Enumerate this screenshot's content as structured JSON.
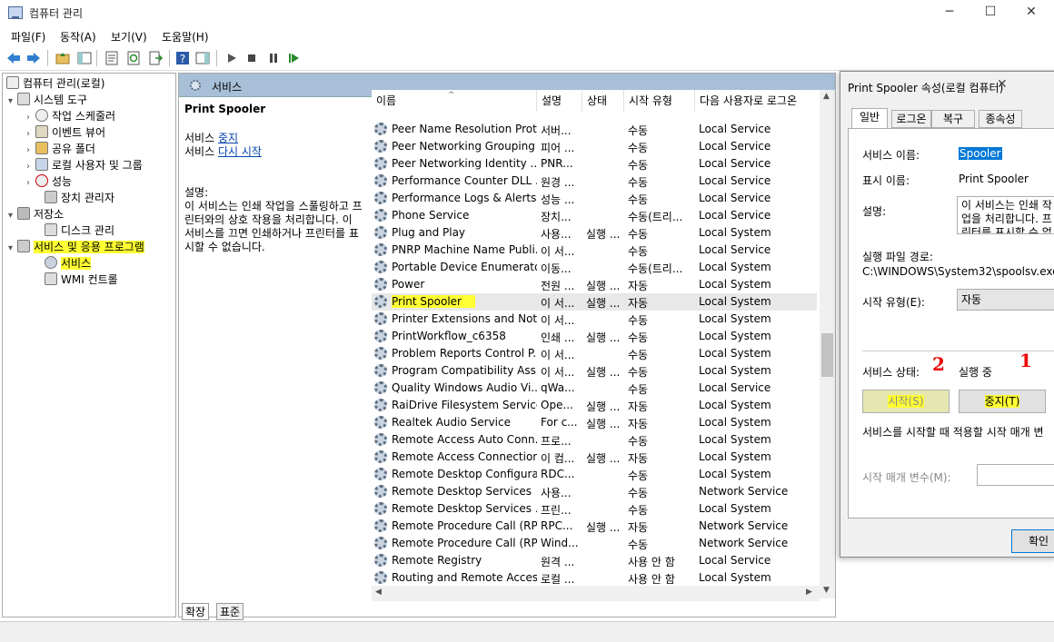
{
  "window": {
    "title": "컴퓨터 관리",
    "min": "─",
    "max": "☐",
    "close": "✕"
  },
  "menu": [
    "파일(F)",
    "동작(A)",
    "보기(V)",
    "도움말(H)"
  ],
  "tree": [
    {
      "label": "컴퓨터 관리(로컬)",
      "twisty": ""
    },
    {
      "label": "시스템 도구",
      "twisty": "▾"
    },
    {
      "label": "작업 스케줄러",
      "twisty": "›"
    },
    {
      "label": "이벤트 뷰어",
      "twisty": "›"
    },
    {
      "label": "공유 폴더",
      "twisty": "›"
    },
    {
      "label": "로컬 사용자 및 그룹",
      "twisty": "›"
    },
    {
      "label": "성능",
      "twisty": "›"
    },
    {
      "label": "장치 관리자",
      "twisty": ""
    },
    {
      "label": "저장소",
      "twisty": "▾"
    },
    {
      "label": "디스크 관리",
      "twisty": ""
    },
    {
      "label": "서비스 및 응용 프로그램",
      "twisty": "▾"
    },
    {
      "label": "서비스",
      "twisty": ""
    },
    {
      "label": "WMI 컨트롤",
      "twisty": ""
    }
  ],
  "services_header": "서비스",
  "info": {
    "title": "Print Spooler",
    "service_word": "서비스",
    "stop_link": "중지",
    "restart_link": "다시 시작",
    "desc_label": "설명:",
    "desc": "이 서비스는 인쇄 작업을 스풀링하고 프린터와의 상호 작용을 처리합니다. 이 서비스를 끄면 인쇄하거나 프린터를 표시할 수 없습니다."
  },
  "columns": [
    "이름",
    "설명",
    "상태",
    "시작 유형",
    "다음 사용자로 로그온"
  ],
  "services": [
    [
      "Peer Name Resolution Prot...",
      "서버...",
      "",
      "수동",
      "Local Service"
    ],
    [
      "Peer Networking Grouping",
      "피어 ...",
      "",
      "수동",
      "Local Service"
    ],
    [
      "Peer Networking Identity ...",
      "PNR...",
      "",
      "수동",
      "Local Service"
    ],
    [
      "Performance Counter DLL ...",
      "원경 ...",
      "",
      "수동",
      "Local Service"
    ],
    [
      "Performance Logs & Alerts",
      "성능 ...",
      "",
      "수동",
      "Local Service"
    ],
    [
      "Phone Service",
      "장치...",
      "",
      "수동(트리...",
      "Local Service"
    ],
    [
      "Plug and Play",
      "사용...",
      "실행 ...",
      "수동",
      "Local System"
    ],
    [
      "PNRP Machine Name Publi...",
      "이 서...",
      "",
      "수동",
      "Local Service"
    ],
    [
      "Portable Device Enumerato...",
      "이동...",
      "",
      "수동(트리...",
      "Local System"
    ],
    [
      "Power",
      "전원 ...",
      "실행 ...",
      "자동",
      "Local System"
    ],
    [
      "Print Spooler",
      "이 서...",
      "실행 ...",
      "자동",
      "Local System"
    ],
    [
      "Printer Extensions and Noti...",
      "이 서...",
      "",
      "수동",
      "Local System"
    ],
    [
      "PrintWorkflow_c6358",
      "인쇄 ...",
      "실행 ...",
      "수동",
      "Local System"
    ],
    [
      "Problem Reports Control P...",
      "이 서...",
      "",
      "수동",
      "Local System"
    ],
    [
      "Program Compatibility Assi...",
      "이 서...",
      "실행 ...",
      "수동",
      "Local System"
    ],
    [
      "Quality Windows Audio Vi...",
      "qWa...",
      "",
      "수동",
      "Local Service"
    ],
    [
      "RaiDrive Filesystem Service",
      "Ope...",
      "실행 ...",
      "자동",
      "Local System"
    ],
    [
      "Realtek Audio Service",
      "For c...",
      "실행 ...",
      "자동",
      "Local System"
    ],
    [
      "Remote Access Auto Conn...",
      "프로...",
      "",
      "수동",
      "Local System"
    ],
    [
      "Remote Access Connection...",
      "이 컴...",
      "실행 ...",
      "자동",
      "Local System"
    ],
    [
      "Remote Desktop Configura...",
      "RDC...",
      "",
      "수동",
      "Local System"
    ],
    [
      "Remote Desktop Services",
      "사용...",
      "",
      "수동",
      "Network Service"
    ],
    [
      "Remote Desktop Services ...",
      "프린...",
      "",
      "수동",
      "Local System"
    ],
    [
      "Remote Procedure Call (RP...",
      "RPC...",
      "실행 ...",
      "자동",
      "Network Service"
    ],
    [
      "Remote Procedure Call (RP...",
      "Wind...",
      "",
      "수동",
      "Network Service"
    ],
    [
      "Remote Registry",
      "원격 ...",
      "",
      "사용 안 함",
      "Local Service"
    ],
    [
      "Routing and Remote Access",
      "로컬 ...",
      "",
      "사용 안 함",
      "Local System"
    ]
  ],
  "bottom_tabs": [
    "확장",
    "표준"
  ],
  "dialog": {
    "title": "Print Spooler 속성(로컬 컴퓨터)",
    "close": "✕",
    "tabs": [
      "일반",
      "로그온",
      "복구",
      "종속성"
    ],
    "service_name_label": "서비스 이름:",
    "service_name": "Spooler",
    "display_name_label": "표시 이름:",
    "display_name": "Print Spooler",
    "desc_label": "설명:",
    "desc": "이 서비스는 인쇄 작업을 처리합니다. 프린터를 표시할 수 없",
    "path_label": "실행 파일 경로:",
    "path": "C:\\WINDOWS\\System32\\spoolsv.exe",
    "startup_label": "시작 유형(E):",
    "startup": "자동",
    "status_label": "서비스 상태:",
    "status": "실행 중",
    "start_btn": "시작(S)",
    "stop_btn": "중지(T)",
    "params_note": "서비스를 시작할 때 적용할 시작 매개 변",
    "params_label": "시작 매개 변수(M):",
    "ok": "확인",
    "mark1": "1",
    "mark2": "2"
  }
}
